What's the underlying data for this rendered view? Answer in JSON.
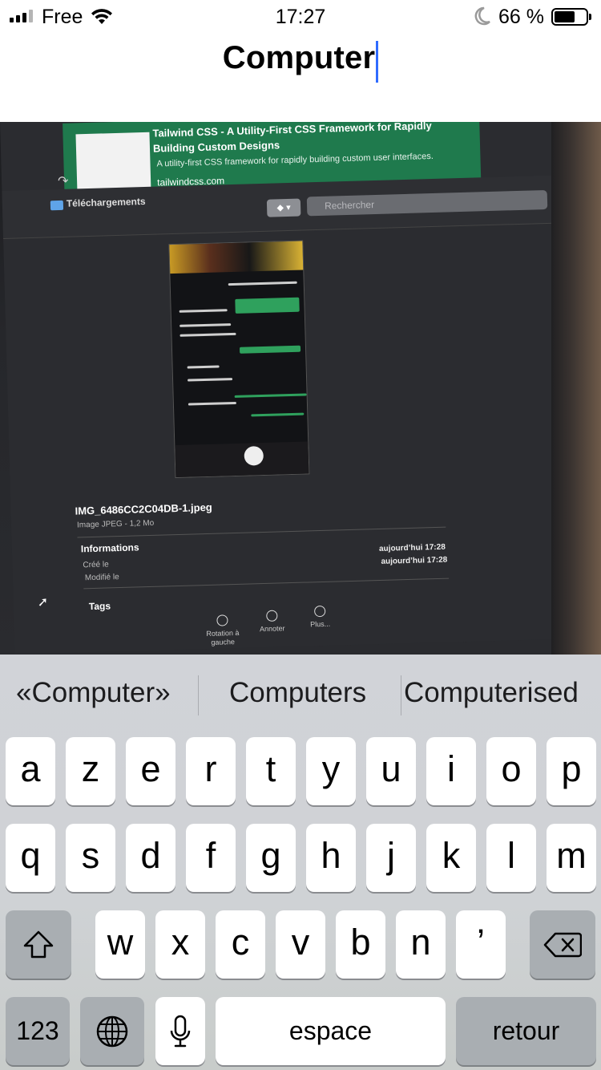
{
  "status_bar": {
    "carrier": "Free",
    "time": "17:27",
    "battery_percent": "66 %",
    "battery_level": 0.66,
    "signal_bars": 3,
    "icons": [
      "signal-icon",
      "wifi-icon",
      "moon-icon",
      "battery-icon"
    ]
  },
  "header": {
    "title": "Computer",
    "caret_color": "#2f6bff"
  },
  "photo": {
    "banner": {
      "title": "Tailwind CSS - A Utility-First CSS Framework for Rapidly Building Custom Designs",
      "description": "A utility-first CSS framework for rapidly building custom user interfaces.",
      "url": "tailwindcss.com",
      "color": "#1f7a4d"
    },
    "finder": {
      "folder": "Téléchargements",
      "search_placeholder": "Rechercher"
    },
    "file": {
      "name": "IMG_6486CC2C04DB-1.jpeg",
      "meta": "Image JPEG - 1,2 Mo",
      "info_heading": "Informations",
      "created_label": "Créé le",
      "created_value": "aujourd’hui 17:28",
      "modified_label": "Modifié le",
      "modified_value": "aujourd’hui 17:28",
      "tags_heading": "Tags"
    },
    "actions": [
      {
        "label": "Rotation à gauche"
      },
      {
        "label": "Annoter"
      },
      {
        "label": "Plus..."
      }
    ]
  },
  "keyboard": {
    "suggestions": [
      "«Computer»",
      "Computers",
      "Computerised"
    ],
    "row1": [
      "a",
      "z",
      "e",
      "r",
      "t",
      "y",
      "u",
      "i",
      "o",
      "p"
    ],
    "row2": [
      "q",
      "s",
      "d",
      "f",
      "g",
      "h",
      "j",
      "k",
      "l",
      "m"
    ],
    "row3": [
      "w",
      "x",
      "c",
      "v",
      "b",
      "n",
      "’"
    ],
    "numbers_label": "123",
    "space_label": "espace",
    "return_label": "retour",
    "icons": [
      "shift-icon",
      "delete-icon",
      "globe-icon",
      "microphone-icon"
    ]
  }
}
